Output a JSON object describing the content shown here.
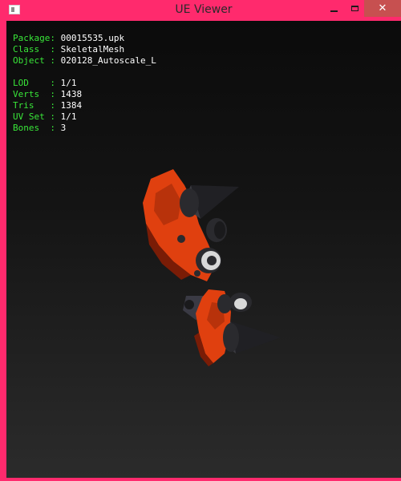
{
  "window": {
    "title": "UE Viewer",
    "icon": "app-window-icon",
    "frame_color": "#ff2a6d",
    "close_color": "#c75050"
  },
  "controls": {
    "minimize": "minimize-icon",
    "maximize": "maximize-icon",
    "close_glyph": "✕"
  },
  "info": {
    "package": {
      "key": "Package:",
      "value": "00015535.upk"
    },
    "class": {
      "key": "Class  :",
      "value": "SkeletalMesh"
    },
    "object": {
      "key": "Object :",
      "value": "020128_Autoscale_L"
    },
    "lod": {
      "key": "LOD    :",
      "value": "1/1"
    },
    "verts": {
      "key": "Verts  :",
      "value": "1438"
    },
    "tris": {
      "key": "Tris   :",
      "value": "1384"
    },
    "uvset": {
      "key": "UV Set :",
      "value": "1/1"
    },
    "bones": {
      "key": "Bones  :",
      "value": "3"
    },
    "key_color": "#39e639",
    "value_color": "#ffffff"
  },
  "viewport": {
    "background_top": "#0b0b0b",
    "background_bottom": "#2b2b2b",
    "model_colors": {
      "body": "#e0400f",
      "dark": "#7a1c06",
      "metal": "#2a2a2e",
      "highlight": "#d8d8d8"
    }
  }
}
